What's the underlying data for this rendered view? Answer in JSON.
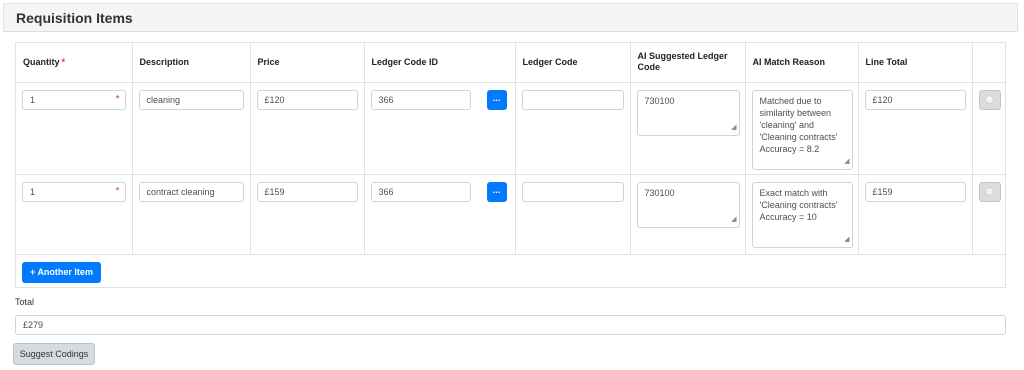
{
  "card": {
    "title": "Requisition Items"
  },
  "table": {
    "headers": {
      "quantity": "Quantity",
      "quantity_required": "*",
      "description": "Description",
      "price": "Price",
      "ledger_code_id": "Ledger Code ID",
      "ledger_code": "Ledger Code",
      "ai_suggested": "AI Suggested Ledger Code",
      "ai_reason": "AI Match Reason",
      "line_total": "Line Total"
    },
    "rows": [
      {
        "quantity": "1",
        "required_mark": "*",
        "description": "cleaning",
        "price": "£120",
        "ledger_code_id": "366",
        "lookup_label": "...",
        "ledger_code": "",
        "ai_suggested": "730100",
        "ai_reason": "Matched due to similarity between 'cleaning' and 'Cleaning contracts' Accuracy = 8.2",
        "line_total": "£120"
      },
      {
        "quantity": "1",
        "required_mark": "*",
        "description": "contract cleaning",
        "price": "£159",
        "ledger_code_id": "366",
        "lookup_label": "...",
        "ledger_code": "",
        "ai_suggested": "730100",
        "ai_reason": "Exact match with 'Cleaning contracts' Accuracy = 10",
        "line_total": "£159"
      }
    ],
    "add_button_label": "Another Item",
    "add_button_icon": "+"
  },
  "total": {
    "label": "Total",
    "value": "£279"
  },
  "suggest_button_label": "Suggest Codings"
}
